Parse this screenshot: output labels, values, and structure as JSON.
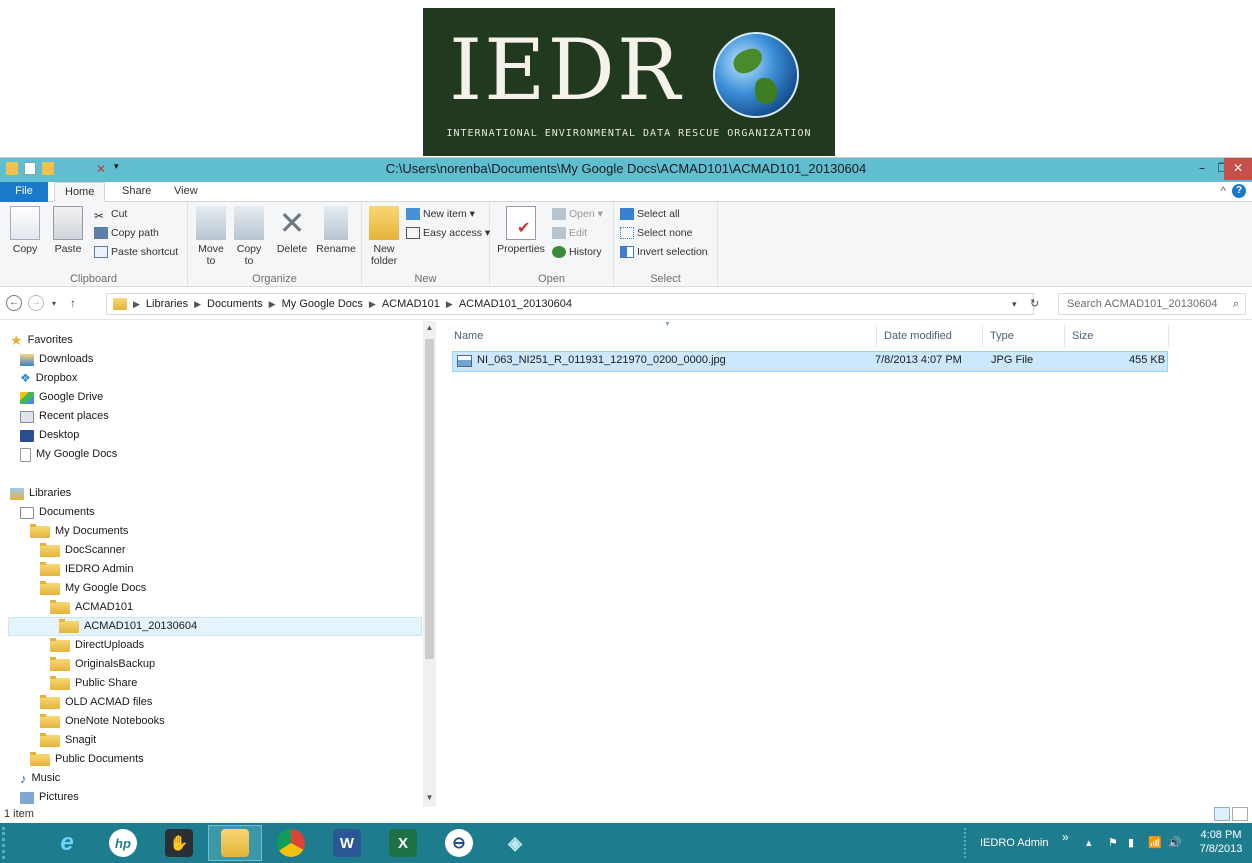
{
  "banner": {
    "logo_letters": "IEDR",
    "logo_subtitle": "INTERNATIONAL ENVIRONMENTAL DATA RESCUE ORGANIZATION"
  },
  "window": {
    "title": "C:\\Users\\norenba\\Documents\\My Google Docs\\ACMAD101\\ACMAD101_20130604",
    "minimize": "–",
    "maximize": "❐",
    "close": "✕"
  },
  "tabs": [
    "File",
    "Home",
    "Share",
    "View"
  ],
  "ribbon": {
    "clipboard": {
      "label": "Clipboard",
      "copy": "Copy",
      "paste": "Paste",
      "cut": "Cut",
      "copy_path": "Copy path",
      "paste_shortcut": "Paste shortcut"
    },
    "organize": {
      "label": "Organize",
      "move_to": "Move",
      "move_to_2": "to",
      "copy_to": "Copy",
      "copy_to_2": "to",
      "delete": "Delete",
      "rename": "Rename"
    },
    "new": {
      "label": "New",
      "new_folder": "New",
      "new_folder_2": "folder",
      "new_item": "New item ▾",
      "easy_access": "Easy access ▾"
    },
    "open": {
      "label": "Open",
      "properties": "Properties",
      "open": "Open ▾",
      "edit": "Edit",
      "history": "History"
    },
    "select": {
      "label": "Select",
      "select_all": "Select all",
      "select_none": "Select none",
      "invert_selection": "Invert selection"
    }
  },
  "address": {
    "crumbs": [
      "Libraries",
      "Documents",
      "My Google Docs",
      "ACMAD101",
      "ACMAD101_20130604"
    ],
    "search_placeholder": "Search ACMAD101_20130604"
  },
  "nav": {
    "items": [
      {
        "label": "Favorites",
        "icon": "star-icon"
      },
      {
        "label": "Downloads",
        "icon": "downloads-icon"
      },
      {
        "label": "Dropbox",
        "icon": "dropbox-icon"
      },
      {
        "label": "Google Drive",
        "icon": "google-drive-icon"
      },
      {
        "label": "Recent places",
        "icon": "recent-places-icon"
      },
      {
        "label": "Desktop",
        "icon": "desktop-icon"
      },
      {
        "label": "My Google Docs",
        "icon": "document-icon"
      },
      {
        "label": "Libraries",
        "icon": "libraries-icon"
      },
      {
        "label": "Documents",
        "icon": "documents-library-icon"
      },
      {
        "label": "My Documents",
        "icon": "folder-icon"
      },
      {
        "label": "DocScanner",
        "icon": "folder-icon"
      },
      {
        "label": "IEDRO Admin",
        "icon": "folder-icon"
      },
      {
        "label": "My Google Docs",
        "icon": "folder-icon"
      },
      {
        "label": "ACMAD101",
        "icon": "folder-icon"
      },
      {
        "label": "ACMAD101_20130604",
        "icon": "folder-icon"
      },
      {
        "label": "DirectUploads",
        "icon": "folder-icon"
      },
      {
        "label": "OriginalsBackup",
        "icon": "folder-icon"
      },
      {
        "label": "Public Share",
        "icon": "folder-icon"
      },
      {
        "label": "OLD ACMAD files",
        "icon": "folder-icon"
      },
      {
        "label": "OneNote Notebooks",
        "icon": "folder-icon"
      },
      {
        "label": "Snagit",
        "icon": "folder-icon"
      },
      {
        "label": "Public Documents",
        "icon": "folder-icon"
      },
      {
        "label": "Music",
        "icon": "music-icon"
      },
      {
        "label": "Pictures",
        "icon": "pictures-icon"
      }
    ]
  },
  "list": {
    "columns": [
      "Name",
      "Date modified",
      "Type",
      "Size"
    ],
    "rows": [
      {
        "name": "NI_063_NI251_R_011931_121970_0200_0000.jpg",
        "date": "7/8/2013 4:07 PM",
        "type": "JPG File",
        "size": "455 KB"
      }
    ]
  },
  "status": {
    "count": "1 item"
  },
  "taskbar": {
    "tray_label": "IEDRO Admin",
    "tray_more": "»",
    "time": "4:08 PM",
    "date": "7/8/2013"
  },
  "colors": {
    "titlebar": "#5fbfd0",
    "taskbar": "#1d7d8e",
    "selection": "#cce8ff",
    "file_tab": "#1979ca"
  }
}
